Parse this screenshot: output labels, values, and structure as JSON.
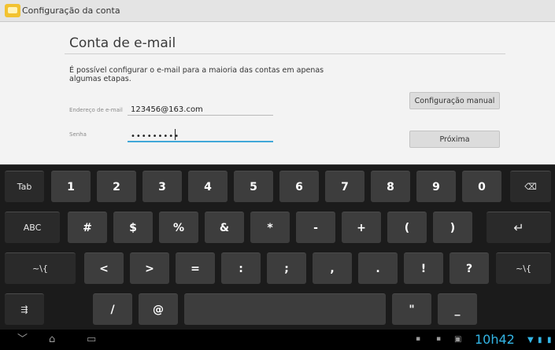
{
  "titlebar": {
    "title": "Configuração da conta"
  },
  "form": {
    "heading": "Conta de e-mail",
    "description": "É possível configurar o e-mail para a maioria das contas em apenas algumas etapas.",
    "email_label": "Endereço de e-mail",
    "email_value": "123456@163.com",
    "password_label": "Senha",
    "password_value": "•••••••••",
    "manual_button": "Configuração manual",
    "next_button": "Próxima"
  },
  "keyboard": {
    "row1": [
      "Tab",
      "1",
      "2",
      "3",
      "4",
      "5",
      "6",
      "7",
      "8",
      "9",
      "0",
      "⌫"
    ],
    "row2": [
      "ABC",
      "#",
      "$",
      "%",
      "&",
      "*",
      "-",
      "+",
      "(",
      ")",
      "↵"
    ],
    "row3": [
      "~\\{",
      "<",
      ">",
      "=",
      ":",
      ";",
      ",",
      ".",
      "!",
      "?",
      "~\\{"
    ],
    "row4": [
      "⇶",
      "/",
      "@",
      "",
      "\"",
      "_"
    ]
  },
  "statusbar": {
    "clock": "10h42",
    "icons": [
      "back-icon",
      "home-icon",
      "recents-icon",
      "wifi-icon",
      "battery-icon"
    ]
  },
  "colors": {
    "accent": "#33b5e5",
    "focus": "#41a8d8"
  }
}
